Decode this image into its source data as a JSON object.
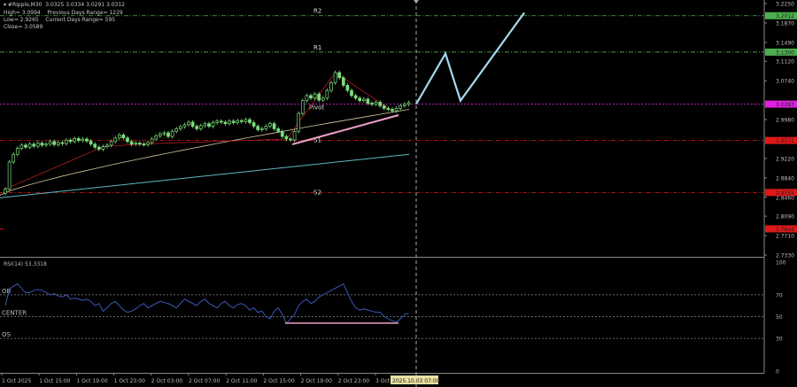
{
  "header": {
    "symbol_line": "#Ripple,M30  3.0325 3.0334 3.0291 3.0312",
    "high_line": "High= 3.0994    Previous Days Range= 1229",
    "low_line": "Low= 2.9265    Current Days Range= 595",
    "close_line": "Close= 3.0589"
  },
  "chart_data": {
    "type": "candlestick",
    "symbol": "#Ripple",
    "timeframe": "M30",
    "ylim": [
      2.733,
      3.225
    ],
    "y_ticks": [
      "3.2250",
      "3.1870",
      "3.1490",
      "3.1120",
      "3.0740",
      "2.9980",
      "2.9220",
      "2.8840",
      "2.8460",
      "2.8090",
      "2.7710",
      "2.7330"
    ],
    "x_ticks": [
      "1 Oct 2025",
      "1 Oct 15:00",
      "1 Oct 19:00",
      "1 Oct 23:00",
      "2 Oct 03:00",
      "2 Oct 07:00",
      "2 Oct 11:00",
      "2 Oct 15:00",
      "2 Oct 19:00",
      "2 Oct 23:00",
      "3 Oct"
    ],
    "current_time_label": "2025.10.03 07:00",
    "closes": [
      2.862,
      2.915,
      2.93,
      2.942,
      2.948,
      2.944,
      2.95,
      2.946,
      2.952,
      2.948,
      2.95,
      2.955,
      2.949,
      2.953,
      2.951,
      2.958,
      2.955,
      2.961,
      2.957,
      2.96,
      2.956,
      2.95,
      2.944,
      2.94,
      2.945,
      2.948,
      2.955,
      2.962,
      2.968,
      2.962,
      2.955,
      2.95,
      2.952,
      2.95,
      2.949,
      2.953,
      2.96,
      2.966,
      2.97,
      2.972,
      2.965,
      2.975,
      2.98,
      2.984,
      2.988,
      2.993,
      2.985,
      2.98,
      2.986,
      2.99,
      2.985,
      2.992,
      2.995,
      2.993,
      2.99,
      2.995,
      2.992,
      2.996,
      2.994,
      2.998,
      2.992,
      2.985,
      2.978,
      2.98,
      2.985,
      2.99,
      2.98,
      2.975,
      2.965,
      2.96,
      2.958,
      2.975,
      3.01,
      3.035,
      3.045,
      3.04,
      3.048,
      3.036,
      3.04,
      3.055,
      3.07,
      3.09,
      3.08,
      3.065,
      3.055,
      3.045,
      3.04,
      3.035,
      3.038,
      3.03,
      3.028,
      3.032,
      3.025,
      3.02,
      3.018,
      3.015,
      3.02,
      3.025,
      3.028,
      3.031
    ],
    "levels": [
      {
        "name": "R2",
        "value": 3.2012,
        "label": "3.2012",
        "color": "#4caf50"
      },
      {
        "name": "R1",
        "value": 3.13,
        "label": "3.1300",
        "color": "#4caf50"
      },
      {
        "name": "Pivot",
        "value": 3.0283,
        "label": "3.0283",
        "color": "#e020e0"
      },
      {
        "name": "S1",
        "value": 2.9571,
        "label": "2.9571",
        "color": "#e01818"
      },
      {
        "name": "S2",
        "value": 2.8554,
        "label": "2.8554",
        "color": "#e01818"
      },
      {
        "name": "",
        "value": 2.7842,
        "label": "2.7842",
        "color": "#e01818"
      }
    ],
    "ma_slow": [
      2.845,
      2.93
    ],
    "ma_fast": [
      2.85,
      3.018
    ],
    "forecast": [
      3.0283,
      3.127,
      3.035,
      3.207
    ],
    "forecast_color": "#a8d8f0",
    "rsi": {
      "label": "RSI(14) 53.3318",
      "levels": [
        {
          "name": "OB",
          "value": 70
        },
        {
          "name": "CENTER",
          "value": 50
        },
        {
          "name": "OS",
          "value": 30
        }
      ],
      "y_ticks": [
        "100",
        "70",
        "50",
        "30",
        "0"
      ],
      "values": [
        60,
        75,
        78,
        80,
        76,
        72,
        72,
        74,
        75,
        74,
        72,
        70,
        71,
        69,
        68,
        70,
        66,
        67,
        66,
        65,
        66,
        64,
        60,
        62,
        55,
        58,
        62,
        64,
        60,
        56,
        54,
        55,
        57,
        60,
        62,
        58,
        60,
        62,
        64,
        63,
        62,
        60,
        58,
        62,
        66,
        64,
        62,
        60,
        64,
        66,
        62,
        60,
        58,
        62,
        64,
        60,
        58,
        61,
        62,
        60,
        56,
        58,
        54,
        55,
        50,
        48,
        55,
        58,
        52,
        44,
        48,
        52,
        60,
        64,
        66,
        62,
        64,
        68,
        70,
        72,
        74,
        76,
        78,
        80,
        72,
        64,
        58,
        56,
        57,
        56,
        55,
        54,
        54,
        50,
        48,
        46,
        45,
        48,
        52,
        53
      ]
    },
    "rsi_divergence_value": 44
  }
}
